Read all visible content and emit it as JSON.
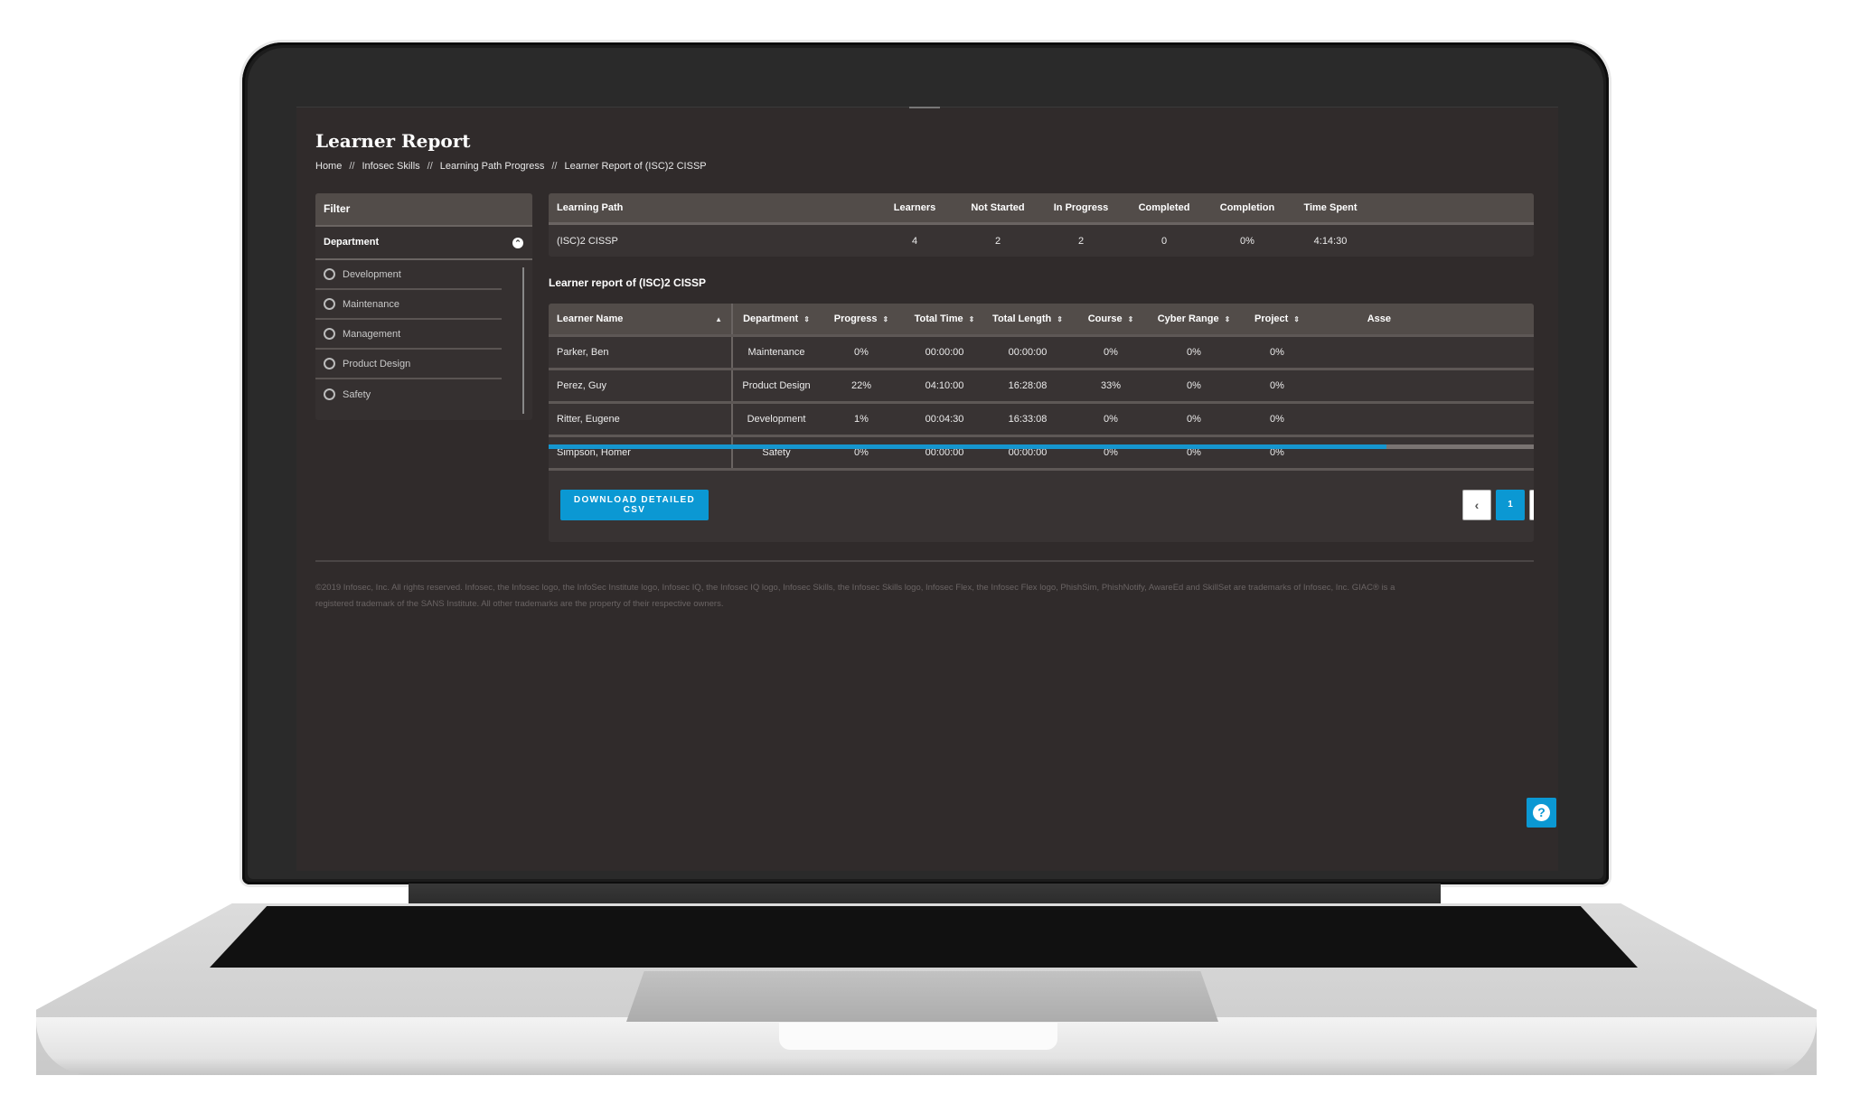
{
  "page": {
    "title": "Learner Report",
    "breadcrumb": [
      "Home",
      "Infosec Skills",
      "Learning Path Progress",
      "Learner Report of (ISC)2 CISSP"
    ],
    "breadcrumb_separator": "//"
  },
  "filter": {
    "header": "Filter",
    "group_label": "Department",
    "options": [
      "Development",
      "Maintenance",
      "Management",
      "Product Design",
      "Safety"
    ]
  },
  "summary": {
    "columns": [
      "Learning Path",
      "Learners",
      "Not Started",
      "In Progress",
      "Completed",
      "Completion",
      "Time Spent"
    ],
    "row": [
      "(ISC)2 CISSP",
      "4",
      "2",
      "2",
      "0",
      "0%",
      "4:14:30"
    ]
  },
  "learner_report": {
    "heading": "Learner report of (ISC)2 CISSP",
    "columns": [
      "Learner Name",
      "Department",
      "Progress",
      "Total Time",
      "Total Length",
      "Course",
      "Cyber Range",
      "Project",
      "Asse"
    ],
    "rows": [
      [
        "Parker, Ben",
        "Maintenance",
        "0%",
        "00:00:00",
        "00:00:00",
        "0%",
        "0%",
        "0%"
      ],
      [
        "Perez, Guy",
        "Product Design",
        "22%",
        "04:10:00",
        "16:28:08",
        "33%",
        "0%",
        "0%"
      ],
      [
        "Ritter, Eugene",
        "Development",
        "1%",
        "00:04:30",
        "16:33:08",
        "0%",
        "0%",
        "0%"
      ],
      [
        "Simpson, Homer",
        "Safety",
        "0%",
        "00:00:00",
        "00:00:00",
        "0%",
        "0%",
        "0%"
      ]
    ],
    "horizontal_scroll_fraction": 0.85,
    "download_label": "DOWNLOAD DETAILED CSV",
    "pagination": {
      "prev": "‹",
      "current_page": "1",
      "next": "›"
    }
  },
  "footer": {
    "line1": "©2019 Infosec, Inc. All rights reserved. Infosec, the Infosec logo, the InfoSec Institute logo, Infosec IQ, the Infosec IQ logo, Infosec Skills, the Infosec Skills logo, Infosec Flex, the Infosec Flex logo, PhishSim, PhishNotify, AwareEd and SkillSet are trademarks of Infosec, Inc. GIAC® is a",
    "line2": "registered trademark of the SANS Institute. All other trademarks are the property of their respective owners."
  },
  "help": {
    "icon": "question-circle-icon",
    "label": "?"
  },
  "colors": {
    "accent": "#0b98d3",
    "background": "#302b2b",
    "header": "#524c49"
  }
}
